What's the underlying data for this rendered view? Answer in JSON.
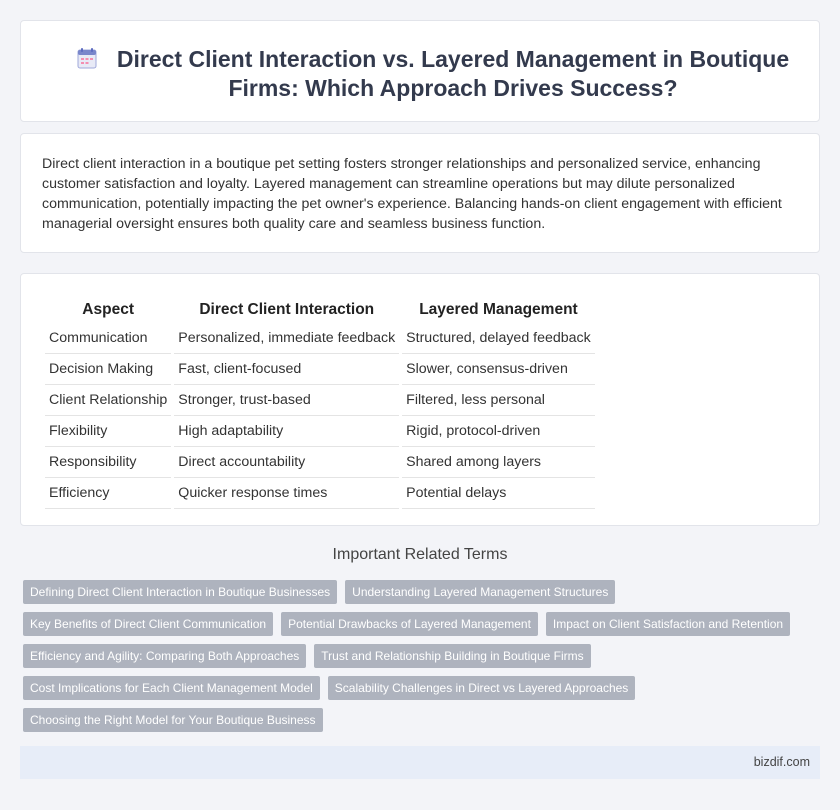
{
  "header": {
    "title": "Direct Client Interaction vs. Layered Management in Boutique Firms: Which Approach Drives Success?",
    "icon": "calendar-document-icon"
  },
  "intro": {
    "text": "Direct client interaction in a boutique pet setting fosters stronger relationships and personalized service, enhancing customer satisfaction and loyalty. Layered management can streamline operations but may dilute personalized communication, potentially impacting the pet owner's experience. Balancing hands-on client engagement with efficient managerial oversight ensures both quality care and seamless business function."
  },
  "table": {
    "headers": [
      "Aspect",
      "Direct Client Interaction",
      "Layered Management"
    ],
    "rows": [
      [
        "Communication",
        "Personalized, immediate feedback",
        "Structured, delayed feedback"
      ],
      [
        "Decision Making",
        "Fast, client-focused",
        "Slower, consensus-driven"
      ],
      [
        "Client Relationship",
        "Stronger, trust-based",
        "Filtered, less personal"
      ],
      [
        "Flexibility",
        "High adaptability",
        "Rigid, protocol-driven"
      ],
      [
        "Responsibility",
        "Direct accountability",
        "Shared among layers"
      ],
      [
        "Efficiency",
        "Quicker response times",
        "Potential delays"
      ]
    ]
  },
  "related": {
    "title": "Important Related Terms",
    "rows": [
      [
        "Defining Direct Client Interaction in Boutique Businesses",
        "Understanding Layered Management Structures"
      ],
      [
        "Key Benefits of Direct Client Communication",
        "Potential Drawbacks of Layered Management",
        "Impact on Client Satisfaction and Retention"
      ],
      [
        "Efficiency and Agility: Comparing Both Approaches",
        "Trust and Relationship Building in Boutique Firms"
      ],
      [
        "Cost Implications for Each Client Management Model",
        "Scalability Challenges in Direct vs Layered Approaches"
      ],
      [
        "Choosing the Right Model for Your Boutique Business"
      ]
    ]
  },
  "footer": {
    "text": "bizdif.com"
  },
  "colors": {
    "tag_bg": "#aeb3be",
    "footer_bg": "#e7edf8",
    "page_bg": "#f3f4f8"
  }
}
